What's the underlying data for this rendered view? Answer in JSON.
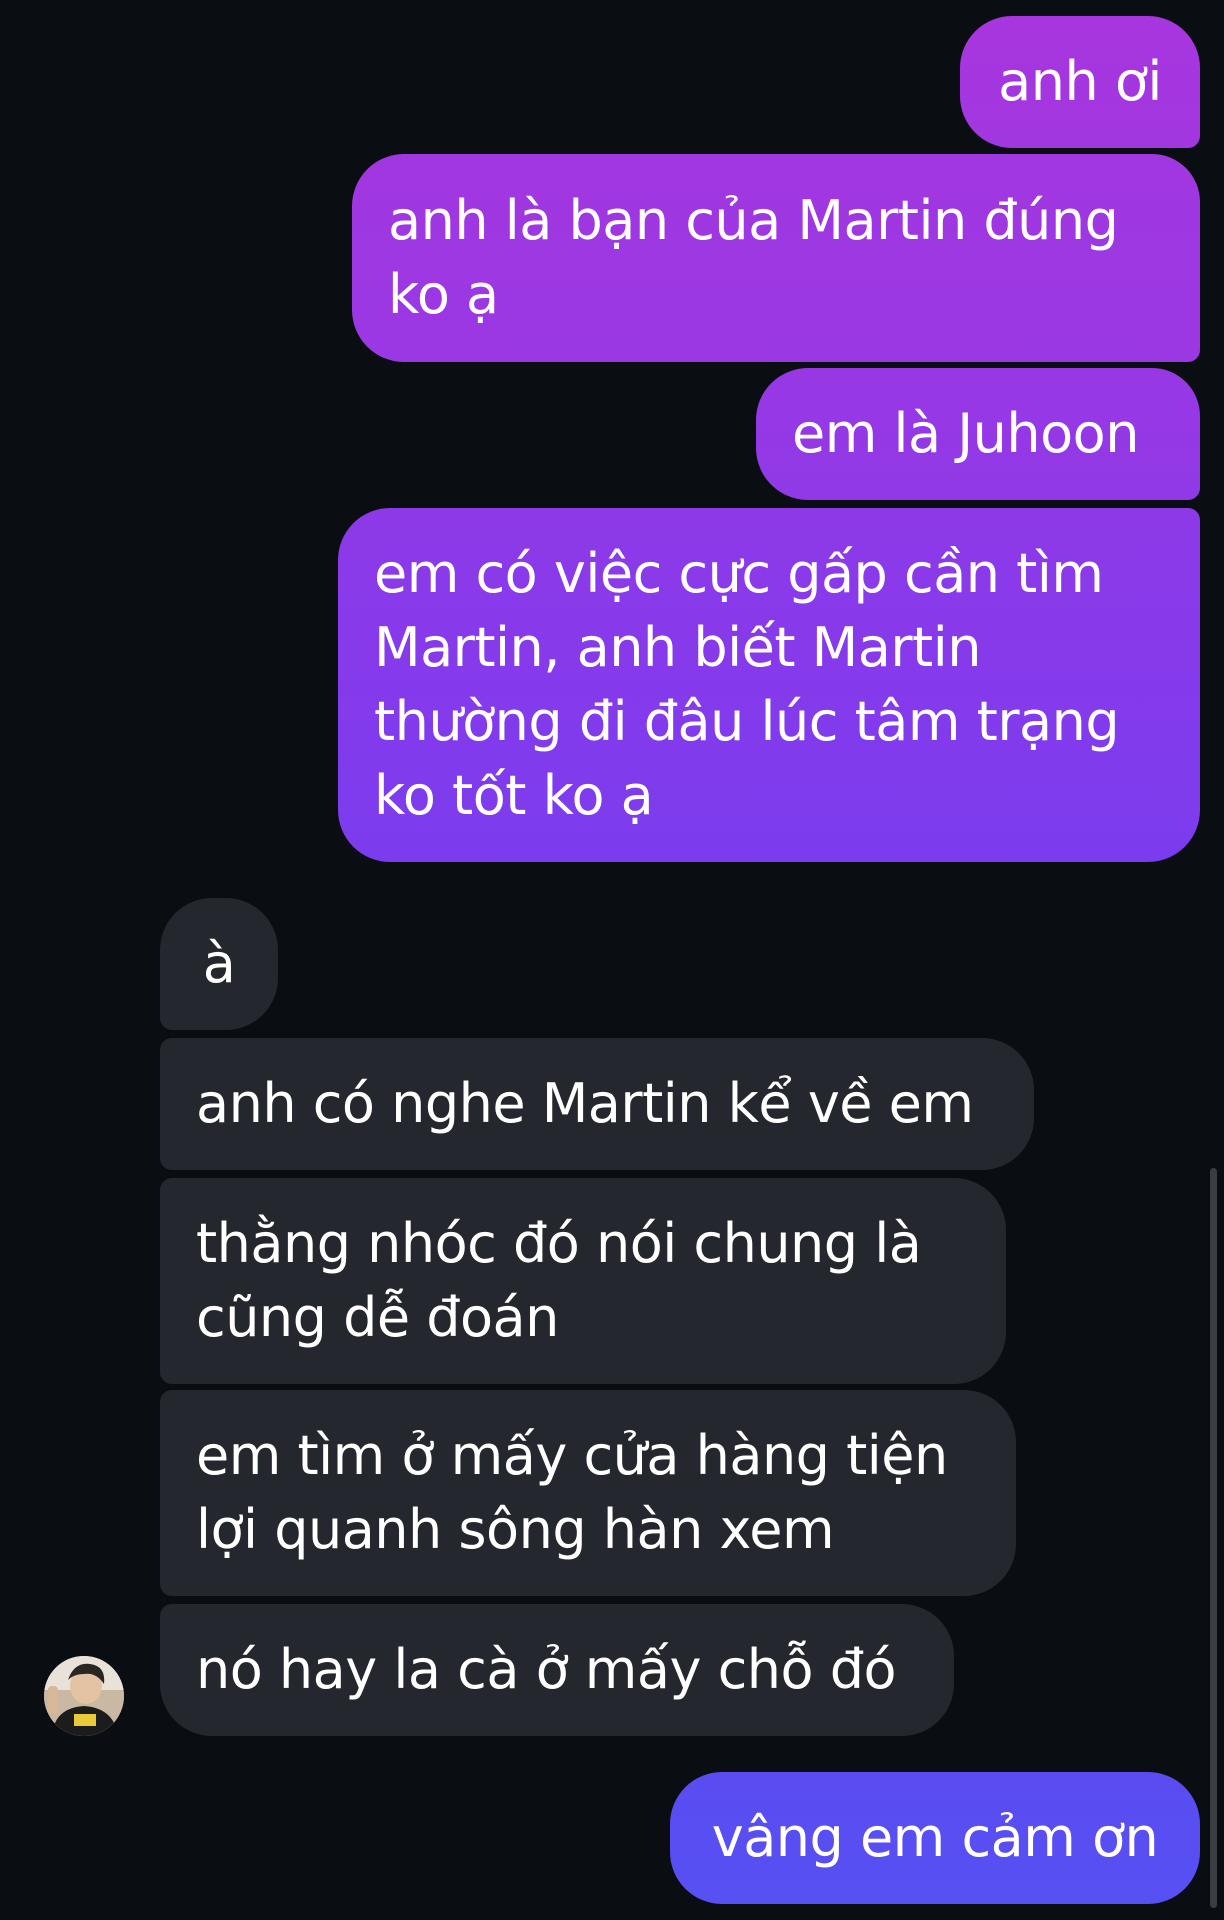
{
  "messages": {
    "outgoing": [
      {
        "text": "anh ơi"
      },
      {
        "text": "anh là bạn của Martin đúng ko ạ"
      },
      {
        "text": "em là Juhoon"
      },
      {
        "text": "em có việc cực gấp cần tìm Martin, anh biết Martin thường đi đâu lúc tâm trạng ko tốt ko ạ"
      }
    ],
    "incoming": [
      {
        "text": "à"
      },
      {
        "text": "anh có nghe Martin kể về em"
      },
      {
        "text": "thằng nhóc đó nói chung là cũng dễ đoán"
      },
      {
        "text": "em tìm ở mấy cửa hàng tiện lợi quanh sông hàn xem"
      },
      {
        "text": "nó hay la cà ở mấy chỗ đó"
      }
    ],
    "reply": {
      "text": "vâng em cảm ơn"
    }
  },
  "colors": {
    "background": "#0a0d12",
    "incoming_bubble": "#25272e",
    "outgoing_top": "#a236e0",
    "outgoing_bottom": "#5b4ff2"
  },
  "contact": {
    "avatar_icon": "contact-avatar-icon"
  }
}
